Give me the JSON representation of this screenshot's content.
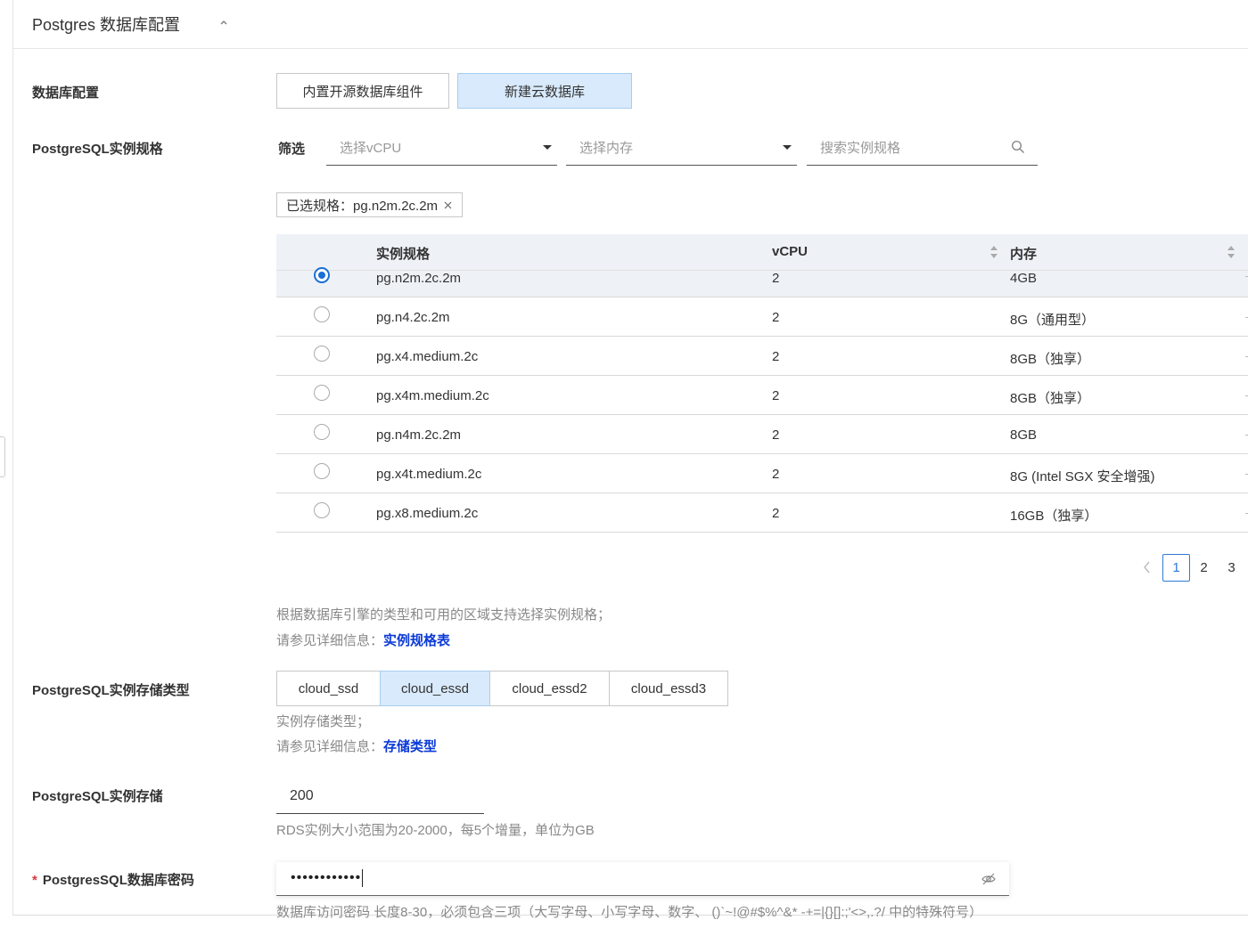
{
  "section": {
    "title": "Postgres 数据库配置",
    "collapse_icon": "chevron-up-icon"
  },
  "db_config": {
    "label": "数据库配置",
    "options": [
      "内置开源数据库组件",
      "新建云数据库"
    ],
    "selected": "新建云数据库"
  },
  "instance_spec": {
    "label": "PostgreSQL实例规格",
    "filter_label": "筛选",
    "vcpu_placeholder": "选择vCPU",
    "memory_placeholder": "选择内存",
    "search_placeholder": "搜索实例规格",
    "selected_tag": "已选规格：pg.n2m.2c.2m",
    "table": {
      "headers": {
        "spec": "实例规格",
        "vcpu": "vCPU",
        "memory": "内存"
      },
      "rows": [
        {
          "spec": "pg.n2m.2c.2m",
          "vcpu": "2",
          "memory": "4GB",
          "checked": true
        },
        {
          "spec": "pg.n4.2c.2m",
          "vcpu": "2",
          "memory": "8G（通用型）",
          "checked": false
        },
        {
          "spec": "pg.x4.medium.2c",
          "vcpu": "2",
          "memory": "8GB（独享）",
          "checked": false
        },
        {
          "spec": "pg.x4m.medium.2c",
          "vcpu": "2",
          "memory": "8GB（独享）",
          "checked": false
        },
        {
          "spec": "pg.n4m.2c.2m",
          "vcpu": "2",
          "memory": "8GB",
          "checked": false
        },
        {
          "spec": "pg.x4t.medium.2c",
          "vcpu": "2",
          "memory": "8G (Intel SGX 安全增强)",
          "checked": false
        },
        {
          "spec": "pg.x8.medium.2c",
          "vcpu": "2",
          "memory": "16GB（独享）",
          "checked": false
        }
      ]
    },
    "pagination": {
      "pages": [
        "1",
        "2",
        "3"
      ],
      "current": "1"
    },
    "help_line1": "根据数据库引擎的类型和可用的区域支持选择实例规格；",
    "help_line2": "请参见详细信息：",
    "help_link": "实例规格表"
  },
  "storage_type": {
    "label": "PostgreSQL实例存储类型",
    "options": [
      "cloud_ssd",
      "cloud_essd",
      "cloud_essd2",
      "cloud_essd3"
    ],
    "selected": "cloud_essd",
    "help_line1": "实例存储类型；",
    "help_line2": "请参见详细信息：",
    "help_link": "存储类型"
  },
  "storage": {
    "label": "PostgreSQL实例存储",
    "value": "200",
    "help": "RDS实例大小范围为20-2000，每5个增量，单位为GB"
  },
  "password": {
    "required_mark": "*",
    "label": "PostgresSQL数据库密码",
    "value": "••••••••••••",
    "help": "数据库访问密码 长度8-30，必须包含三项（大写字母、小写字母、数字、 ()`~!@#$%^&* -+=|{}[]:;'<>,.?/ 中的特殊符号）"
  },
  "colors": {
    "accent": "#1a6fd6",
    "active_bg": "#d8eafb",
    "link": "#0b3ad6",
    "table_header_bg": "#eef2f7"
  }
}
